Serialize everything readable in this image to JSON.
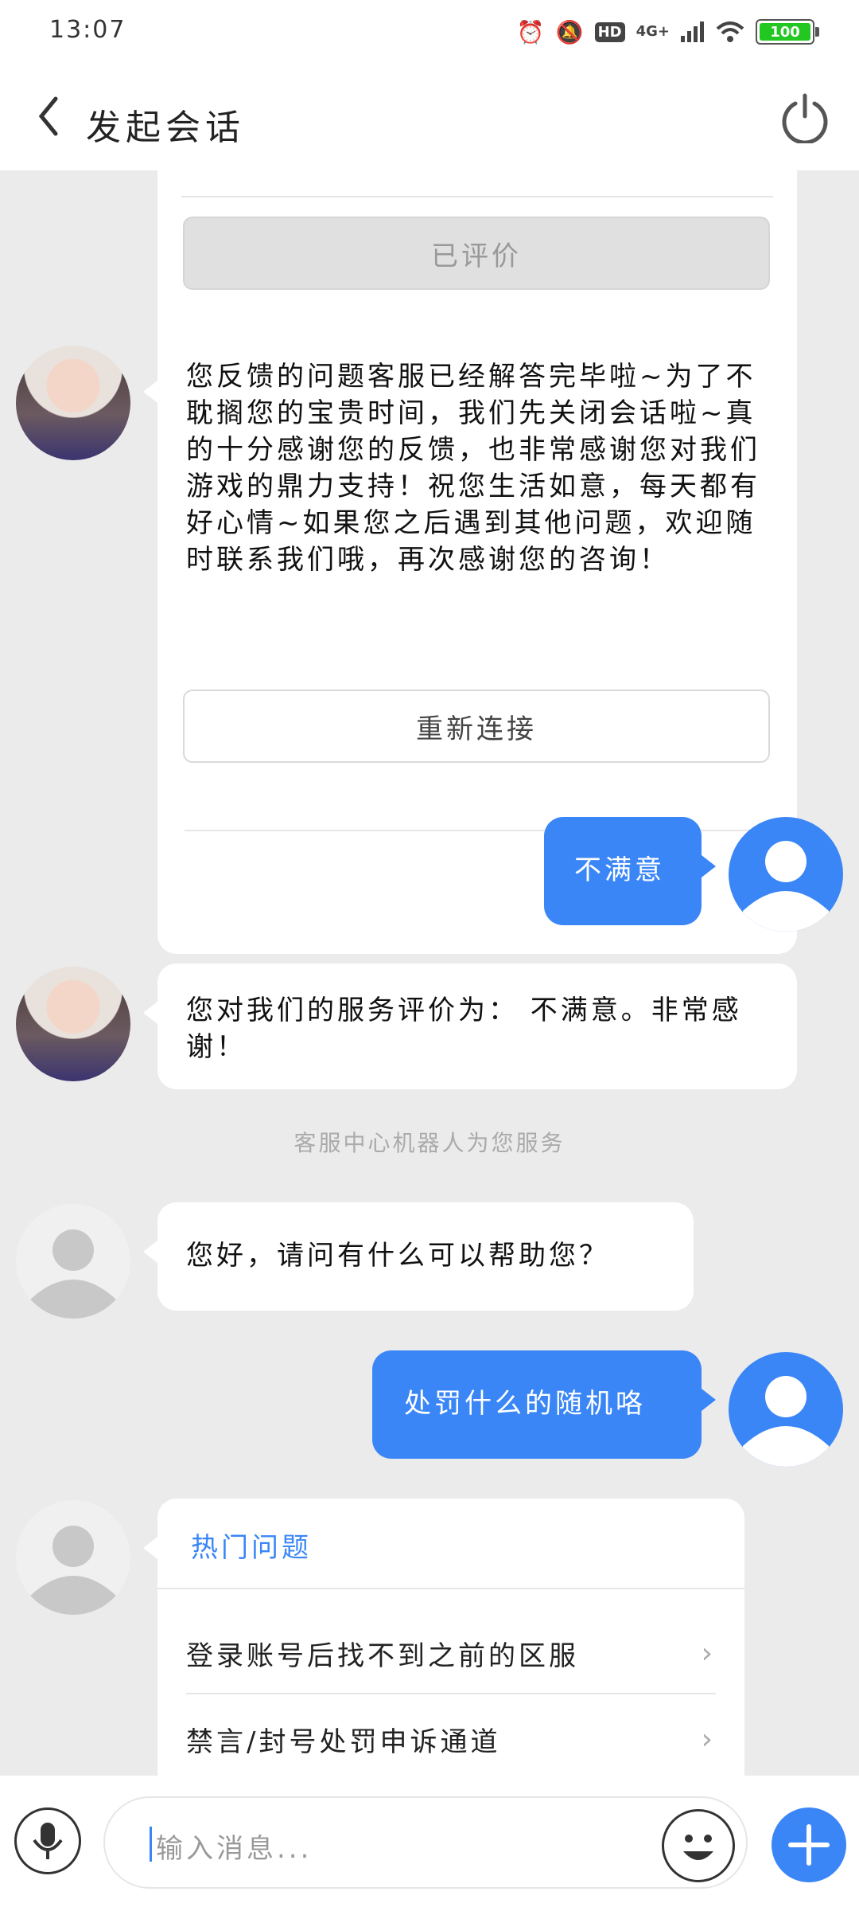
{
  "status_bar": {
    "time": "13:07",
    "network": "4G+",
    "hd": "HD",
    "battery": "100"
  },
  "header": {
    "title": "发起会话"
  },
  "messages": [
    {
      "button_label": "已评价"
    },
    {
      "text": "您反馈的问题客服已经解答完毕啦~为了不耽搁您的宝贵时间，我们先关闭会话啦~真的十分感谢您的反馈，也非常感谢您对我们游戏的鼎力支持！祝您生活如意，每天都有好心情~如果您之后遇到其他问题，欢迎随时联系我们哦，再次感谢您的咨询！",
      "button_label": "重新连接"
    },
    {
      "text": "不满意"
    },
    {
      "text": "您对我们的服务评价为： 不满意。非常感谢！"
    },
    {
      "system_note": "客服中心机器人为您服务"
    },
    {
      "text": "您好，请问有什么可以帮助您？"
    },
    {
      "text": "处罚什么的随机咯"
    },
    {
      "title": "热门问题",
      "items": [
        "登录账号后找不到之前的区服",
        "禁言/封号处罚申诉通道"
      ]
    }
  ],
  "input_bar": {
    "placeholder": "输入消息..."
  },
  "colors": {
    "accent": "#3a86f7",
    "background": "#ebebeb",
    "bubble": "#ffffff"
  }
}
